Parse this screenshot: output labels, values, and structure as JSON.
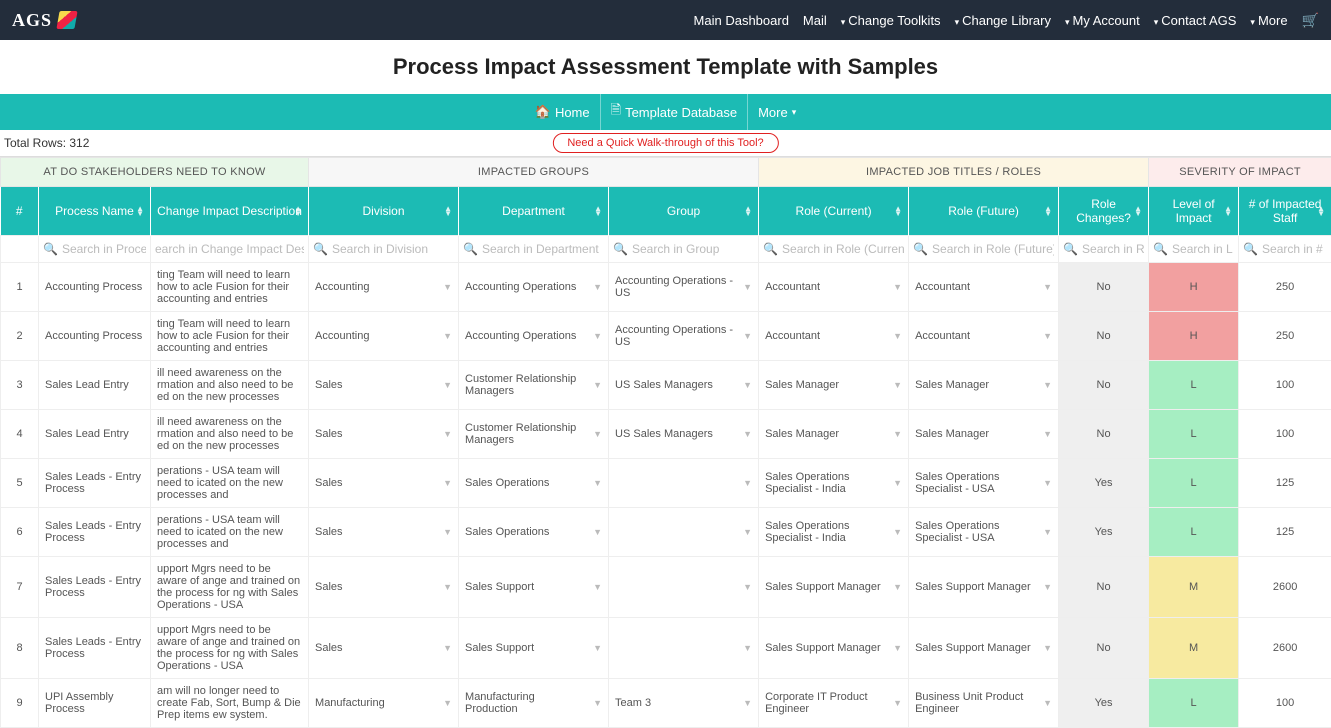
{
  "topnav": {
    "logo": "AGS",
    "links": {
      "dashboard": "Main Dashboard",
      "mail": "Mail",
      "toolkits": "Change Toolkits",
      "library": "Change Library",
      "account": "My Account",
      "contact": "Contact AGS",
      "more": "More"
    }
  },
  "page_title": "Process Impact Assessment Template with Samples",
  "teal_bar": {
    "home": "Home",
    "template_db": "Template Database",
    "more": "More"
  },
  "info": {
    "total_rows_label": "Total Rows: 312",
    "walkthrough": "Need a Quick Walk-through of this Tool?"
  },
  "group_headers": {
    "know": "AT DO STAKEHOLDERS NEED TO KNOW",
    "impacted_groups": "IMPACTED GROUPS",
    "impacted_roles": "IMPACTED JOB TITLES / ROLES",
    "severity": "SEVERITY OF IMPACT"
  },
  "columns": {
    "idx": "#",
    "process_name": "Process Name",
    "change_desc": "Change Impact Description",
    "division": "Division",
    "department": "Department",
    "group": "Group",
    "role_current": "Role (Current)",
    "role_future": "Role (Future)",
    "role_changes": "Role Changes?",
    "level": "Level of Impact",
    "staff": "# of Impacted Staff"
  },
  "search_placeholders": {
    "process_name": "Search in Proce",
    "change_desc": "earch in Change Impact Des",
    "division": "Search in Division",
    "department": "Search in Department",
    "group": "Search in Group",
    "role_current": "Search in Role (Curren",
    "role_future": "Search in Role (Future)",
    "role_changes": "Search in R",
    "level": "Search in L",
    "staff": "Search in #"
  },
  "rows": [
    {
      "idx": "1",
      "process": "Accounting Process",
      "desc": "ting Team will need to learn how to acle Fusion for their accounting and entries",
      "division": "Accounting",
      "department": "Accounting Operations",
      "group": "Accounting Operations - US",
      "role_c": "Accountant",
      "role_f": "Accountant",
      "rch": "No",
      "lvl": "H",
      "staff": "250"
    },
    {
      "idx": "2",
      "process": "Accounting Process",
      "desc": "ting Team will need to learn how to acle Fusion for their accounting and entries",
      "division": "Accounting",
      "department": "Accounting Operations",
      "group": "Accounting Operations - US",
      "role_c": "Accountant",
      "role_f": "Accountant",
      "rch": "No",
      "lvl": "H",
      "staff": "250"
    },
    {
      "idx": "3",
      "process": "Sales Lead Entry",
      "desc": "ill need awareness on the rmation and also need to be ed on the new processes",
      "division": "Sales",
      "department": "Customer Relationship Managers",
      "group": "US Sales Managers",
      "role_c": "Sales Manager",
      "role_f": "Sales Manager",
      "rch": "No",
      "lvl": "L",
      "staff": "100"
    },
    {
      "idx": "4",
      "process": "Sales Lead Entry",
      "desc": "ill need awareness on the rmation and also need to be ed on the new processes",
      "division": "Sales",
      "department": "Customer Relationship Managers",
      "group": "US Sales Managers",
      "role_c": "Sales Manager",
      "role_f": "Sales Manager",
      "rch": "No",
      "lvl": "L",
      "staff": "100"
    },
    {
      "idx": "5",
      "process": "Sales Leads - Entry Process",
      "desc": "perations - USA team will need to icated on the new processes and",
      "division": "Sales",
      "department": "Sales Operations",
      "group": "",
      "role_c": "Sales Operations Specialist - India",
      "role_f": "Sales Operations Specialist - USA",
      "rch": "Yes",
      "lvl": "L",
      "staff": "125"
    },
    {
      "idx": "6",
      "process": "Sales Leads - Entry Process",
      "desc": "perations - USA team will need to icated on the new processes and",
      "division": "Sales",
      "department": "Sales Operations",
      "group": "",
      "role_c": "Sales Operations Specialist - India",
      "role_f": "Sales Operations Specialist - USA",
      "rch": "Yes",
      "lvl": "L",
      "staff": "125"
    },
    {
      "idx": "7",
      "process": "Sales Leads - Entry Process",
      "desc": "upport Mgrs need to be aware of ange and trained on the process for ng with Sales Operations - USA",
      "division": "Sales",
      "department": "Sales Support",
      "group": "",
      "role_c": "Sales Support Manager",
      "role_f": "Sales Support Manager",
      "rch": "No",
      "lvl": "M",
      "staff": "2600"
    },
    {
      "idx": "8",
      "process": "Sales Leads - Entry Process",
      "desc": "upport Mgrs need to be aware of ange and trained on the process for ng with Sales Operations - USA",
      "division": "Sales",
      "department": "Sales Support",
      "group": "",
      "role_c": "Sales Support Manager",
      "role_f": "Sales Support Manager",
      "rch": "No",
      "lvl": "M",
      "staff": "2600"
    },
    {
      "idx": "9",
      "process": "UPI Assembly Process",
      "desc": "am will no longer need to create Fab, Sort, Bump & Die Prep items ew system.",
      "division": "Manufacturing",
      "department": "Manufacturing Production",
      "group": "Team 3",
      "role_c": "Corporate IT Product Engineer",
      "role_f": "Business Unit Product Engineer",
      "rch": "Yes",
      "lvl": "L",
      "staff": "100"
    }
  ]
}
